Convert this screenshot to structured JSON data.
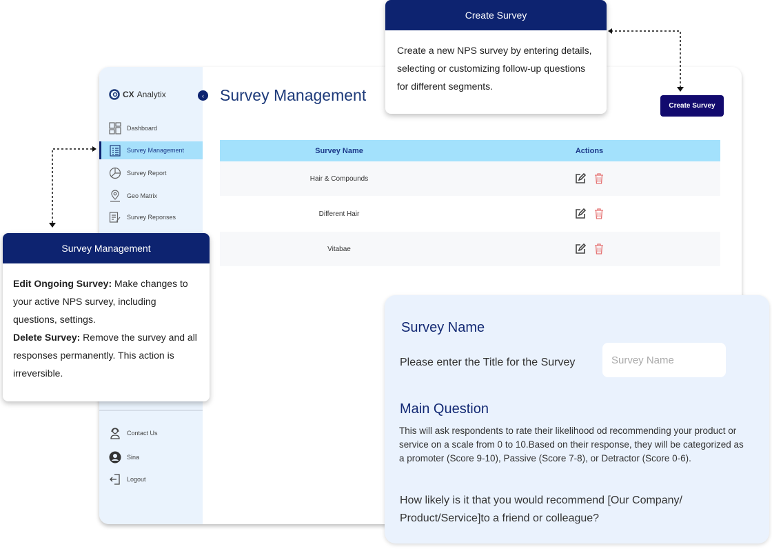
{
  "app": {
    "logo": {
      "brand_bold": "CX",
      "brand_rest": "Analytix"
    },
    "page_title": "Survey Management",
    "create_button": "Create Survey",
    "sidebar": {
      "items": [
        {
          "label": "Dashboard",
          "icon": "dashboard-icon"
        },
        {
          "label": "Survey Management",
          "icon": "clipboard-list-icon",
          "active": true
        },
        {
          "label": "Survey Report",
          "icon": "pie-chart-icon"
        },
        {
          "label": "Geo Matrix",
          "icon": "map-pin-icon"
        },
        {
          "label": "Survey Reponses",
          "icon": "responses-icon"
        }
      ],
      "bottom": [
        {
          "label": "Contact Us",
          "icon": "support-agent-icon"
        },
        {
          "label": "Sina",
          "icon": "user-avatar-icon"
        },
        {
          "label": "Logout",
          "icon": "logout-icon"
        }
      ]
    },
    "table": {
      "headers": [
        "Survey Name",
        "Actions"
      ],
      "rows": [
        {
          "name": "Hair & Compounds"
        },
        {
          "name": "Different Hair"
        },
        {
          "name": "Vitabae"
        }
      ]
    }
  },
  "tooltips": {
    "create": {
      "title": "Create Survey",
      "body": "Create a new NPS survey by entering details, selecting or customizing follow-up questions for different segments."
    },
    "manage": {
      "title": "Survey Management",
      "edit_label": "Edit Ongoing Survey:",
      "edit_text": " Make changes to your active NPS survey, including questions, settings.",
      "delete_label": "Delete Survey:",
      "delete_text": " Remove the survey and all responses permanently. This action is irreversible."
    }
  },
  "form": {
    "survey_name_heading": "Survey Name",
    "survey_name_prompt": "Please enter the Title for the Survey",
    "survey_name_placeholder": "Survey Name",
    "main_question_heading": "Main Question",
    "main_question_description": "This will ask respondents to rate their likelihood od recommending your product or service on a scale from 0 to 10.Based on their response, they will be categorized as a promoter (Score 9-10), Passive (Score 7-8), or Detractor (Score 0-6).",
    "main_question_text": "How likely is it that you would recommend [Our Company/ Product/Service]to a friend or colleague?"
  },
  "colors": {
    "navy": "#0d2370",
    "button": "#120a6e",
    "table_header": "#a3e1fc",
    "sidebar": "#eaf3fd",
    "delete": "#e57373"
  }
}
